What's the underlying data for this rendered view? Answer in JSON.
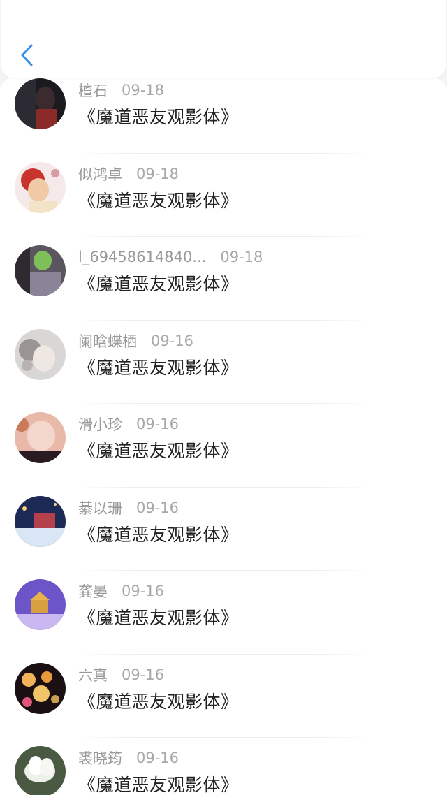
{
  "header": {
    "back_icon": "chevron-left-icon",
    "accent_color": "#3a8ee6"
  },
  "comments": [
    {
      "name": "檀石",
      "date": "09-18",
      "title": "《魔道恶友观影体》",
      "avatar_colors": [
        "#1a1a1f",
        "#3b2a2e",
        "#8c2a2a"
      ]
    },
    {
      "name": "似鸿卓",
      "date": "09-18",
      "title": "《魔道恶友观影体》",
      "avatar_colors": [
        "#f6e9ea",
        "#c8332e",
        "#f0c9a6"
      ]
    },
    {
      "name": "l_69458614840...",
      "date": "09-18",
      "title": "《魔道恶友观影体》",
      "avatar_colors": [
        "#5b5560",
        "#7fbf5a",
        "#8a8498"
      ]
    },
    {
      "name": "阑晗蝶栖",
      "date": "09-16",
      "title": "《魔道恶友观影体》",
      "avatar_colors": [
        "#d9d6d6",
        "#9a9494",
        "#efe7e2"
      ]
    },
    {
      "name": "滑小珍",
      "date": "09-16",
      "title": "《魔道恶友观影体》",
      "avatar_colors": [
        "#e8b9a8",
        "#f3d6cc",
        "#2a1a22"
      ]
    },
    {
      "name": "綦以珊",
      "date": "09-16",
      "title": "《魔道恶友观影体》",
      "avatar_colors": [
        "#1d2a55",
        "#d9e6f5",
        "#b3404a"
      ]
    },
    {
      "name": "龚晏",
      "date": "09-16",
      "title": "《魔道恶友观影体》",
      "avatar_colors": [
        "#6b55c8",
        "#c9b8f0",
        "#e8b34a"
      ]
    },
    {
      "name": "六真",
      "date": "09-16",
      "title": "《魔道恶友观影体》",
      "avatar_colors": [
        "#1a0f12",
        "#f2b45a",
        "#e0557a"
      ]
    },
    {
      "name": "裘晓筠",
      "date": "09-16",
      "title": "《魔道恶友观影体》",
      "avatar_colors": [
        "#4a5a42",
        "#eef0ea",
        "#a9b3a0"
      ]
    }
  ]
}
